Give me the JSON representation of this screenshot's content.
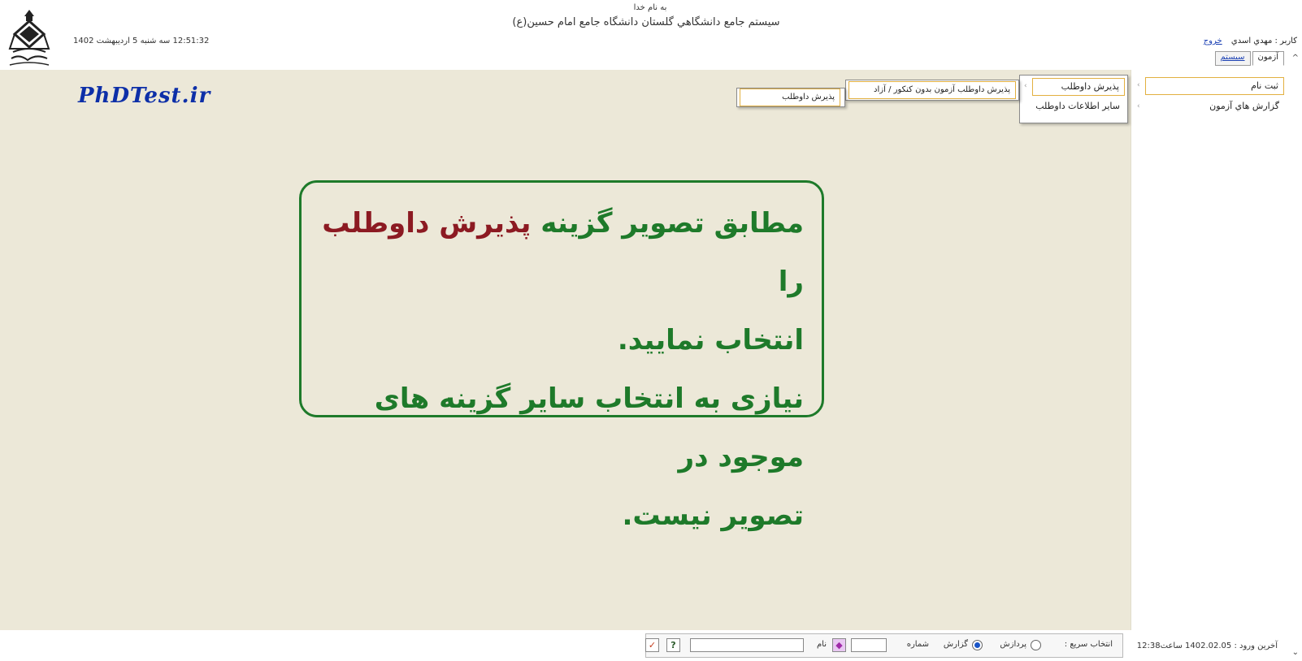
{
  "header": {
    "bismillah": "به نام خدا",
    "system_title": "سيستم جامع دانشگاهي گلستان    دانشگاه جامع امام حسين(ع)",
    "datetime": "12:51:32 سه شنبه 5 ارديبهشت 1402"
  },
  "user": {
    "label": "كاربر : مهدي اسدي",
    "logout": "خروج"
  },
  "tabs": [
    {
      "label": "آزمون",
      "active": true
    },
    {
      "label": "سيستم",
      "active": false
    }
  ],
  "menu": {
    "items": [
      "ثبت نام",
      "گزارش هاي آزمون"
    ],
    "level2": [
      "پذيرش داوطلب",
      "ساير اطلاعات داوطلب"
    ],
    "level3": [
      "پذيرش داوطلب آزمون بدون كنكور / آزاد"
    ],
    "level4": [
      "پذيرش داوطلب"
    ]
  },
  "watermark": "PhDTest.ir",
  "instruction": {
    "line1_pre": "مطابق تصویر گزینه ",
    "line1_highlight": "پذیرش داوطلب",
    "line1_post": " را",
    "line2": "انتخاب نمایید.",
    "line3": "نیازی به انتخاب سایر گزینه های موجود در",
    "line4": "تصویر نیست."
  },
  "quick_bar": {
    "label": "انتخاب سريع :",
    "radio_process": "پردازش",
    "radio_report": "گزارش",
    "selected": "report",
    "number_label": "شماره",
    "name_label": "نام"
  },
  "last_login": "آخرين ورود : 1402.02.05 ساعت12:38",
  "colors": {
    "content_bg": "#ece8d8",
    "instruction_green": "#1e7a2a",
    "instruction_highlight": "#8c1a22",
    "watermark_blue": "#0d2fa8",
    "selected_border": "#e2b040"
  }
}
